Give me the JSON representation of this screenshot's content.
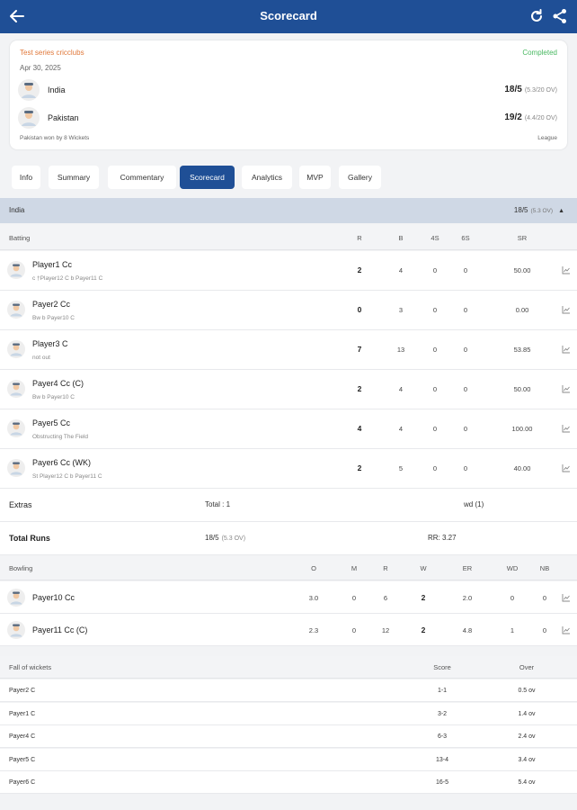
{
  "header": {
    "title": "Scorecard",
    "back_icon": "arrow-left-icon",
    "refresh_icon": "refresh-icon",
    "share_icon": "share-icon"
  },
  "match": {
    "series": "Test series cricclubs",
    "status": "Completed",
    "date": "Apr 30, 2025",
    "teams": [
      {
        "name": "India",
        "score": "18/5",
        "overs": "(5.3/20 OV)"
      },
      {
        "name": "Pakistan",
        "score": "19/2",
        "overs": "(4.4/20 OV)"
      }
    ],
    "result": "Pakistan won by 8 Wickets",
    "type": "League"
  },
  "tabs": [
    {
      "label": "Info",
      "active": false
    },
    {
      "label": "Summary",
      "active": false
    },
    {
      "label": "Commentary",
      "active": false
    },
    {
      "label": "Scorecard",
      "active": true
    },
    {
      "label": "Analytics",
      "active": false
    },
    {
      "label": "MVP",
      "active": false
    },
    {
      "label": "Gallery",
      "active": false
    }
  ],
  "innings": {
    "team": "India",
    "score": "18/5",
    "overs": "(5.3 OV)",
    "toggle": "▲"
  },
  "batting": {
    "headers": {
      "label": "Batting",
      "r": "R",
      "b": "B",
      "fours": "4S",
      "sixes": "6S",
      "sr": "SR"
    },
    "rows": [
      {
        "name": "Player1 Cc",
        "dismissal": "c †Player12 C b Payer11 C",
        "r": "2",
        "b": "4",
        "fours": "0",
        "sixes": "0",
        "sr": "50.00"
      },
      {
        "name": "Payer2 Cc",
        "dismissal": "Bw b Payer10 C",
        "r": "0",
        "b": "3",
        "fours": "0",
        "sixes": "0",
        "sr": "0.00"
      },
      {
        "name": "Player3 C",
        "dismissal": "not out",
        "r": "7",
        "b": "13",
        "fours": "0",
        "sixes": "0",
        "sr": "53.85"
      },
      {
        "name": "Payer4 Cc  (C)",
        "dismissal": "Bw b Payer10 C",
        "r": "2",
        "b": "4",
        "fours": "0",
        "sixes": "0",
        "sr": "50.00"
      },
      {
        "name": "Payer5 Cc",
        "dismissal": "Obstructing The Field",
        "r": "4",
        "b": "4",
        "fours": "0",
        "sixes": "0",
        "sr": "100.00"
      },
      {
        "name": "Payer6 Cc  (WK)",
        "dismissal": "St Player12 C b Payer11 C",
        "r": "2",
        "b": "5",
        "fours": "0",
        "sixes": "0",
        "sr": "40.00"
      }
    ]
  },
  "extras": {
    "label": "Extras",
    "total": "Total : 1",
    "detail": "wd (1)"
  },
  "total_runs": {
    "label": "Total Runs",
    "score": "18/5",
    "overs": "(5.3 OV)",
    "rr": "RR: 3.27"
  },
  "bowling": {
    "headers": {
      "label": "Bowling",
      "o": "O",
      "m": "M",
      "r": "R",
      "w": "W",
      "er": "ER",
      "wd": "WD",
      "nb": "NB"
    },
    "rows": [
      {
        "name": "Payer10 Cc",
        "o": "3.0",
        "m": "0",
        "r": "6",
        "w": "2",
        "er": "2.0",
        "wd": "0",
        "nb": "0"
      },
      {
        "name": "Payer11 Cc  (C)",
        "o": "2.3",
        "m": "0",
        "r": "12",
        "w": "2",
        "er": "4.8",
        "wd": "1",
        "nb": "0"
      }
    ]
  },
  "fow": {
    "headers": {
      "label": "Fall of wickets",
      "score": "Score",
      "over": "Over"
    },
    "rows": [
      {
        "name": "Payer2 C",
        "score": "1-1",
        "over": "0.5 ov"
      },
      {
        "name": "Payer1 C",
        "score": "3-2",
        "over": "1.4 ov"
      },
      {
        "name": "Payer4 C",
        "score": "6-3",
        "over": "2.4 ov"
      },
      {
        "name": "Payer5 C",
        "score": "13-4",
        "over": "3.4 ov"
      },
      {
        "name": "Payer6 C",
        "score": "16-5",
        "over": "5.4 ov"
      }
    ]
  },
  "colors": {
    "primary": "#1f4f96",
    "series": "#e0783a",
    "completed": "#49b861",
    "innings_bg": "#cfd8e5"
  }
}
